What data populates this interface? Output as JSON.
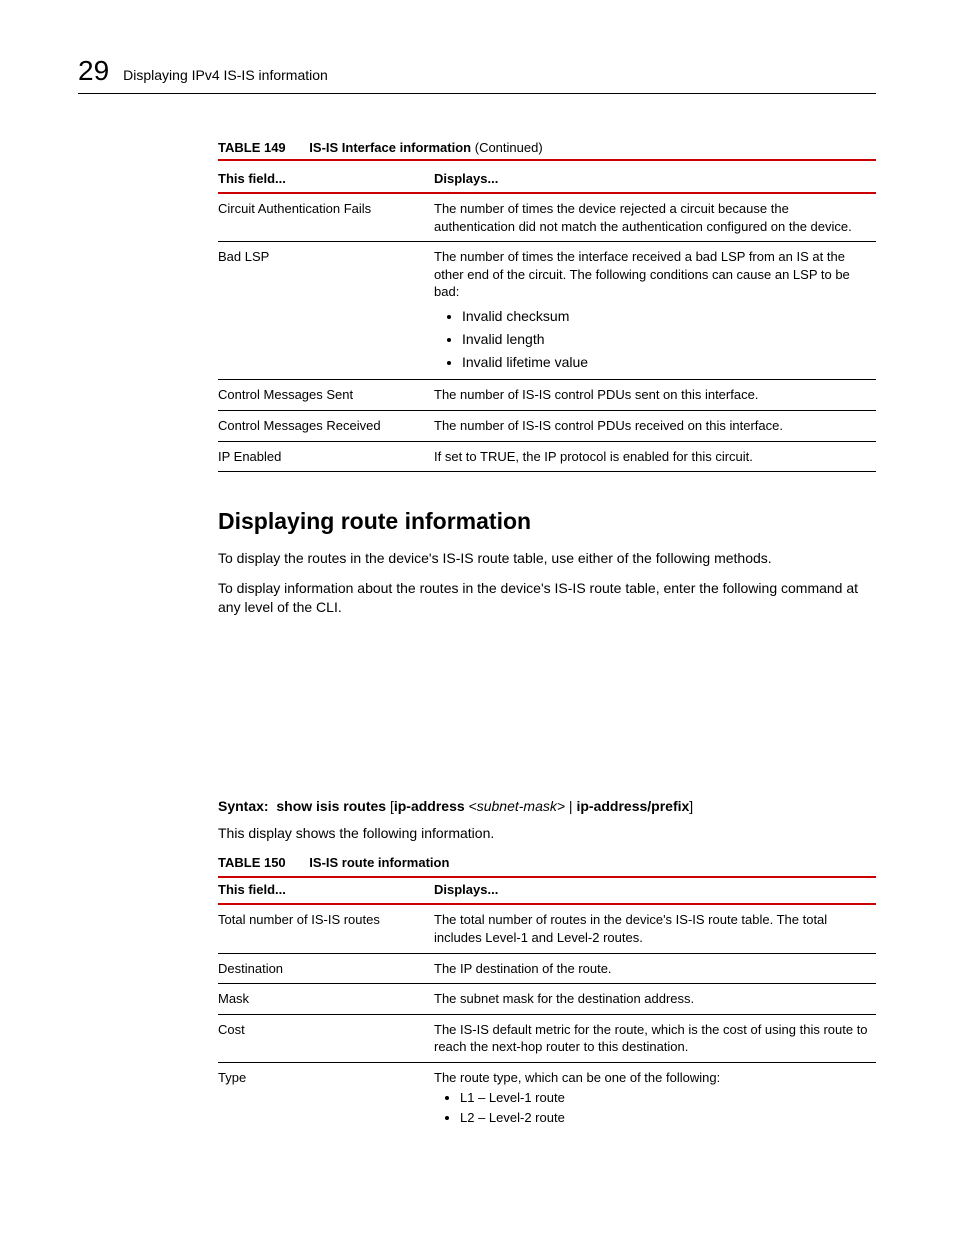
{
  "header": {
    "chapter_number": "29",
    "running_title": "Displaying IPv4 IS-IS information"
  },
  "table149": {
    "label": "TABLE 149",
    "title": "IS-IS Interface information",
    "continued": "(Continued)",
    "col1": "This field...",
    "col2": "Displays...",
    "rows": [
      {
        "field": "Circuit Authentication Fails",
        "display": "The number of times the device rejected a circuit because the authentication did not match the authentication configured on the device."
      },
      {
        "field": "Bad LSP",
        "display_intro": "The number of times the interface received a bad LSP from an IS at the other end of the circuit.  The following conditions can cause an LSP to be bad:",
        "bullets": [
          "Invalid checksum",
          "Invalid length",
          "Invalid lifetime value"
        ]
      },
      {
        "field": "Control Messages Sent",
        "display": "The number of IS-IS control PDUs sent on this interface."
      },
      {
        "field": "Control Messages Received",
        "display": "The number of IS-IS control PDUs received on this interface."
      },
      {
        "field": "IP Enabled",
        "display": "If set to TRUE, the IP protocol is enabled for this circuit."
      }
    ]
  },
  "section": {
    "heading": "Displaying route information",
    "para1": "To display the routes in the device's IS-IS route table, use either of the following methods.",
    "para2": "To display information about the routes in the device's IS-IS route table, enter the following command at any level of the CLI."
  },
  "syntax": {
    "prefix": "Syntax:",
    "cmd": "show isis routes",
    "lbrack": "[",
    "arg1_bold": "ip-address",
    "arg1_ital": "<subnet-mask>",
    "pipe": " | ",
    "arg2_bold": "ip-address/prefix",
    "rbrack": "]"
  },
  "para3": "This display shows the following information.",
  "table150": {
    "label": "TABLE 150",
    "title": "IS-IS route information",
    "col1": "This field...",
    "col2": "Displays...",
    "rows": [
      {
        "field": "Total number of IS-IS routes",
        "display": "The total number of routes in the device's IS-IS route table. The total includes Level-1 and Level-2 routes."
      },
      {
        "field": "Destination",
        "display": "The IP destination of the route."
      },
      {
        "field": "Mask",
        "display": "The subnet mask for the destination address."
      },
      {
        "field": "Cost",
        "display": "The IS-IS default metric for the route, which is the cost of using this route to reach the next-hop router to this destination."
      },
      {
        "field": "Type",
        "display_intro": "The route type, which can be one of the following:",
        "bullets": [
          "L1 – Level-1 route",
          "L2 – Level-2 route"
        ]
      }
    ]
  }
}
